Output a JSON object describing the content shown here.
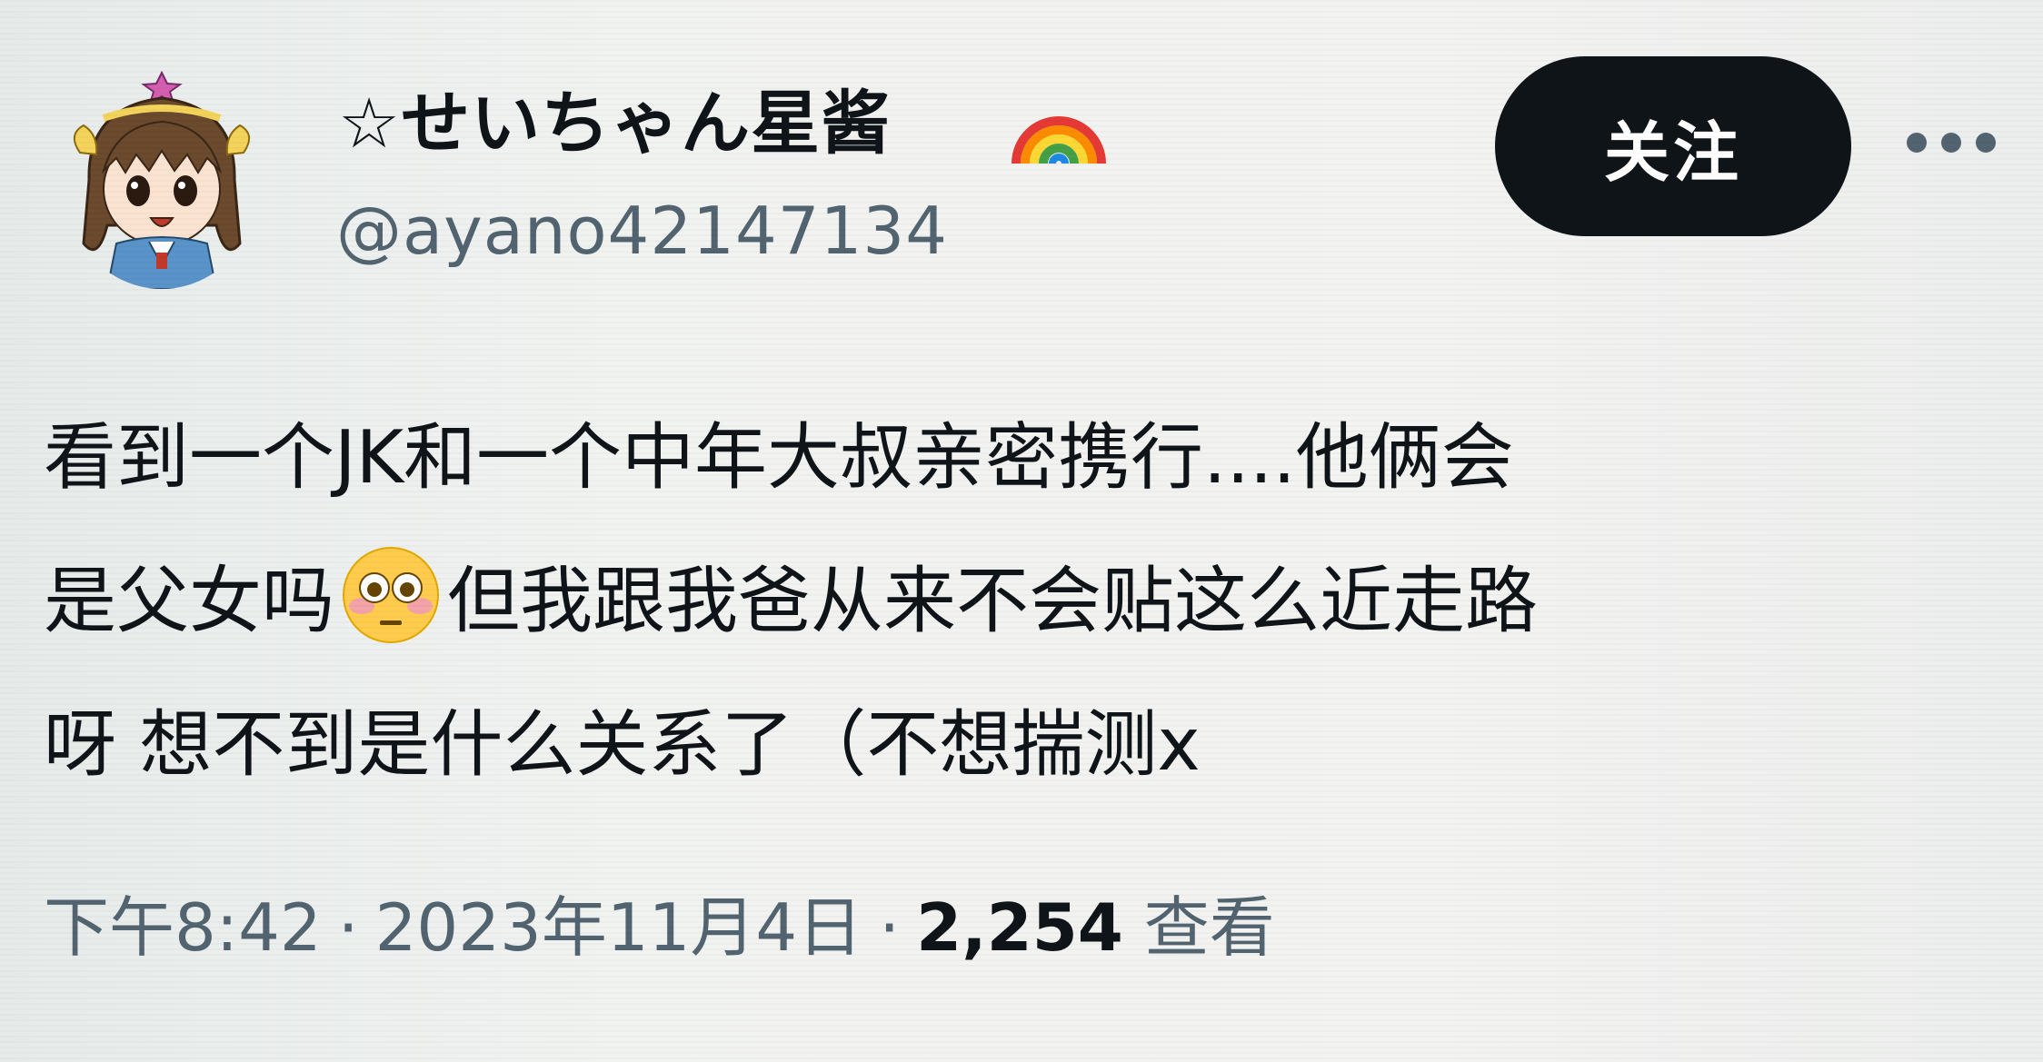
{
  "user": {
    "display_name": "☆せいちゃん星酱",
    "name_emoji": "rainbow",
    "handle": "@ayano42147134",
    "avatar": "anime-girl-avatar"
  },
  "actions": {
    "follow_label": "关注",
    "more_icon": "more-horizontal-icon"
  },
  "tweet": {
    "line1": "看到一个JK和一个中年大叔亲密携行....他俩会",
    "line2_before_emoji": "是父女吗",
    "line2_emoji": "flushed-face",
    "line2_after_emoji": "但我跟我爸从来不会贴这么近走路",
    "line3": "呀 想不到是什么关系了（不想揣测x"
  },
  "meta": {
    "time": "下午8:42",
    "separator": "·",
    "date": "2023年11月4日",
    "views_count": "2,254",
    "views_label": "查看"
  },
  "colors": {
    "text": "#0f1419",
    "secondary": "#536471",
    "button_bg": "#0f1419",
    "button_text": "#ffffff"
  }
}
